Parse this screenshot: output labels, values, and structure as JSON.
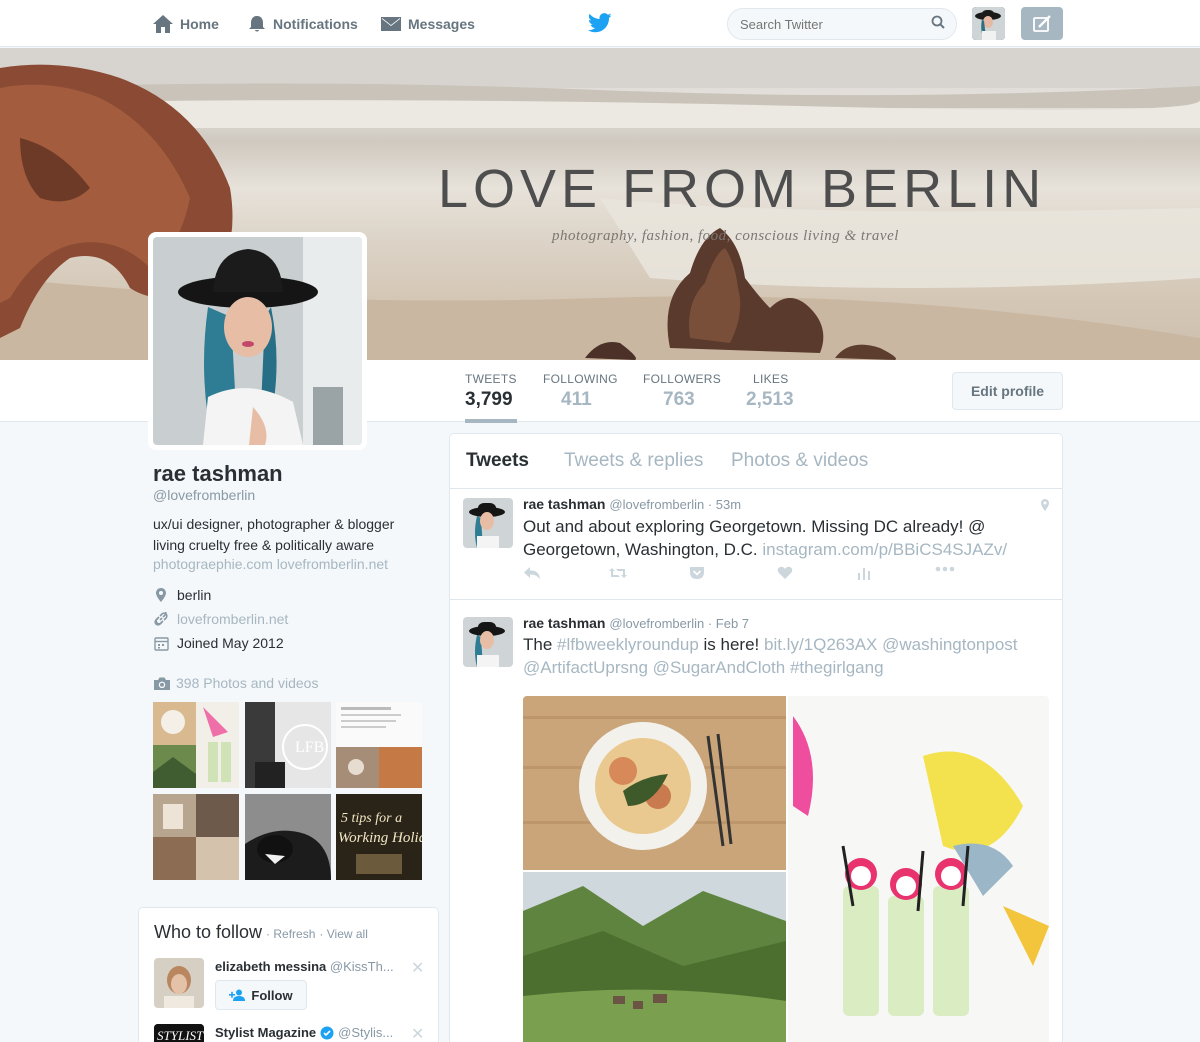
{
  "nav": {
    "home": "Home",
    "notifications": "Notifications",
    "messages": "Messages",
    "search_placeholder": "Search Twitter"
  },
  "banner": {
    "title": "LOVE FROM BERLIN",
    "subtitle": "photography, fashion, food, conscious living & travel"
  },
  "stats": [
    {
      "label": "TWEETS",
      "value": "3,799"
    },
    {
      "label": "FOLLOWING",
      "value": "411"
    },
    {
      "label": "FOLLOWERS",
      "value": "763"
    },
    {
      "label": "LIKES",
      "value": "2,513"
    }
  ],
  "edit_profile": "Edit profile",
  "profile": {
    "name": "rae tashman",
    "handle": "@lovefromberlin",
    "bio_line1": "ux/ui designer, photographer & blogger",
    "bio_line2": "living cruelty free & politically aware",
    "links": "photograephie.com lovefromberlin.net",
    "location": "berlin",
    "website": "lovefromberlin.net",
    "joined": "Joined May 2012",
    "photos_label": "398 Photos and videos"
  },
  "who_to_follow": {
    "title": "Who to follow",
    "refresh": "· Refresh",
    "view_all": "· View all",
    "users": [
      {
        "name": "elizabeth messina",
        "handle": "@KissTh...",
        "button": "Follow"
      },
      {
        "name": "Stylist Magazine",
        "handle": "@Stylis..."
      }
    ]
  },
  "tabs": [
    "Tweets",
    "Tweets & replies",
    "Photos & videos"
  ],
  "tweets": [
    {
      "name": "rae tashman",
      "meta": "@lovefromberlin · 53m",
      "text": "Out and about exploring Georgetown. Missing DC already! @ Georgetown, Washington, D.C. ",
      "link": "instagram.com/p/BBiCS4SJAZv/"
    },
    {
      "name": "rae tashman",
      "meta": "@lovefromberlin · Feb 7",
      "text_a": "The ",
      "hashtag1": "#lfbweeklyroundup",
      "text_b": " is here! ",
      "links": "bit.ly/1Q263AX @washingtonpost @ArtifactUprsng @SugarAndCloth #thegirlgang"
    }
  ],
  "colors": {
    "link_muted": "#a6b7c2",
    "text_primary": "#292f33",
    "twitter_blue": "#1da1f2"
  }
}
